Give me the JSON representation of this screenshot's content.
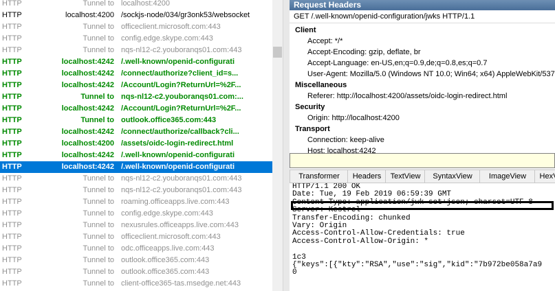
{
  "sessions": [
    {
      "protocol": "HTTP",
      "host": "Tunnel to",
      "url": "localhost:4200",
      "style": "gray"
    },
    {
      "protocol": "HTTP",
      "host": "localhost:4200",
      "url": "/sockjs-node/034/gr3onk53/websocket",
      "style": "black"
    },
    {
      "protocol": "HTTP",
      "host": "Tunnel to",
      "url": "officeclient.microsoft.com:443",
      "style": "gray"
    },
    {
      "protocol": "HTTP",
      "host": "Tunnel to",
      "url": "config.edge.skype.com:443",
      "style": "gray"
    },
    {
      "protocol": "HTTP",
      "host": "Tunnel to",
      "url": "nqs-nl12-c2.youboranqs01.com:443",
      "style": "gray"
    },
    {
      "protocol": "HTTP",
      "host": "localhost:4242",
      "url": "/.well-known/openid-configurati",
      "style": "green"
    },
    {
      "protocol": "HTTP",
      "host": "localhost:4242",
      "url": "/connect/authorize?client_id=s...",
      "style": "green"
    },
    {
      "protocol": "HTTP",
      "host": "localhost:4242",
      "url": "/Account/Login?ReturnUrl=%2F...",
      "style": "green"
    },
    {
      "protocol": "HTTP",
      "host": "Tunnel to",
      "url": "nqs-nl12-c2.youboranqs01.com:...",
      "style": "green"
    },
    {
      "protocol": "HTTP",
      "host": "localhost:4242",
      "url": "/Account/Login?ReturnUrl=%2F...",
      "style": "green"
    },
    {
      "protocol": "HTTP",
      "host": "Tunnel to",
      "url": "outlook.office365.com:443",
      "style": "green"
    },
    {
      "protocol": "HTTP",
      "host": "localhost:4242",
      "url": "/connect/authorize/callback?cli...",
      "style": "green"
    },
    {
      "protocol": "HTTP",
      "host": "localhost:4200",
      "url": "/assets/oidc-login-redirect.html",
      "style": "green"
    },
    {
      "protocol": "HTTP",
      "host": "localhost:4242",
      "url": "/.well-known/openid-configurati",
      "style": "green"
    },
    {
      "protocol": "HTTP",
      "host": "localhost:4242",
      "url": "/.well-known/openid-configurati",
      "style": "sel"
    },
    {
      "protocol": "HTTP",
      "host": "Tunnel to",
      "url": "nqs-nl12-c2.youboranqs01.com:443",
      "style": "gray"
    },
    {
      "protocol": "HTTP",
      "host": "Tunnel to",
      "url": "nqs-nl12-c2.youboranqs01.com:443",
      "style": "gray"
    },
    {
      "protocol": "HTTP",
      "host": "Tunnel to",
      "url": "roaming.officeapps.live.com:443",
      "style": "gray"
    },
    {
      "protocol": "HTTP",
      "host": "Tunnel to",
      "url": "config.edge.skype.com:443",
      "style": "gray"
    },
    {
      "protocol": "HTTP",
      "host": "Tunnel to",
      "url": "nexusrules.officeapps.live.com:443",
      "style": "gray"
    },
    {
      "protocol": "HTTP",
      "host": "Tunnel to",
      "url": "officeclient.microsoft.com:443",
      "style": "gray"
    },
    {
      "protocol": "HTTP",
      "host": "Tunnel to",
      "url": "odc.officeapps.live.com:443",
      "style": "gray"
    },
    {
      "protocol": "HTTP",
      "host": "Tunnel to",
      "url": "outlook.office365.com:443",
      "style": "gray"
    },
    {
      "protocol": "HTTP",
      "host": "Tunnel to",
      "url": "outlook.office365.com:443",
      "style": "gray"
    },
    {
      "protocol": "HTTP",
      "host": "Tunnel to",
      "url": "client-office365-tas.msedge.net:443",
      "style": "gray"
    }
  ],
  "request_panel": {
    "title": "Request Headers",
    "request_line": "GET /.well-known/openid-configuration/jwks HTTP/1.1",
    "groups": [
      {
        "name": "Client",
        "items": [
          "Accept: */*",
          "Accept-Encoding: gzip, deflate, br",
          "Accept-Language: en-US,en;q=0.9,de;q=0.8,es;q=0.7",
          "User-Agent: Mozilla/5.0 (Windows NT 10.0; Win64; x64) AppleWebKit/537."
        ]
      },
      {
        "name": "Miscellaneous",
        "items": [
          "Referer: http://localhost:4200/assets/oidc-login-redirect.html"
        ]
      },
      {
        "name": "Security",
        "items": [
          "Origin: http://localhost:4200"
        ]
      },
      {
        "name": "Transport",
        "items": [
          "Connection: keep-alive",
          "Host: localhost:4242"
        ]
      }
    ]
  },
  "response_tabs": [
    "Transformer",
    "Headers",
    "TextView",
    "SyntaxView",
    "ImageView",
    "HexV"
  ],
  "response_body": [
    "HTTP/1.1 200 OK",
    "Date: Tue, 19 Feb 2019 06:59:39 GMT",
    "Content-Type: application/jwk-set+json; charset=UTF-8",
    "Server: Kestrel",
    "Transfer-Encoding: chunked",
    "Vary: Origin",
    "Access-Control-Allow-Credentials: true",
    "Access-Control-Allow-Origin: *",
    "",
    "1c3",
    "{\"keys\":[{\"kty\":\"RSA\",\"use\":\"sig\",\"kid\":\"7b972be058a7a9",
    "0"
  ],
  "colors": {
    "selected": "#0078d7",
    "green_text": "#008a00",
    "gray_text": "#909090",
    "header_bar": "#4a6f99",
    "yellow_bar": "#ffffe1"
  }
}
